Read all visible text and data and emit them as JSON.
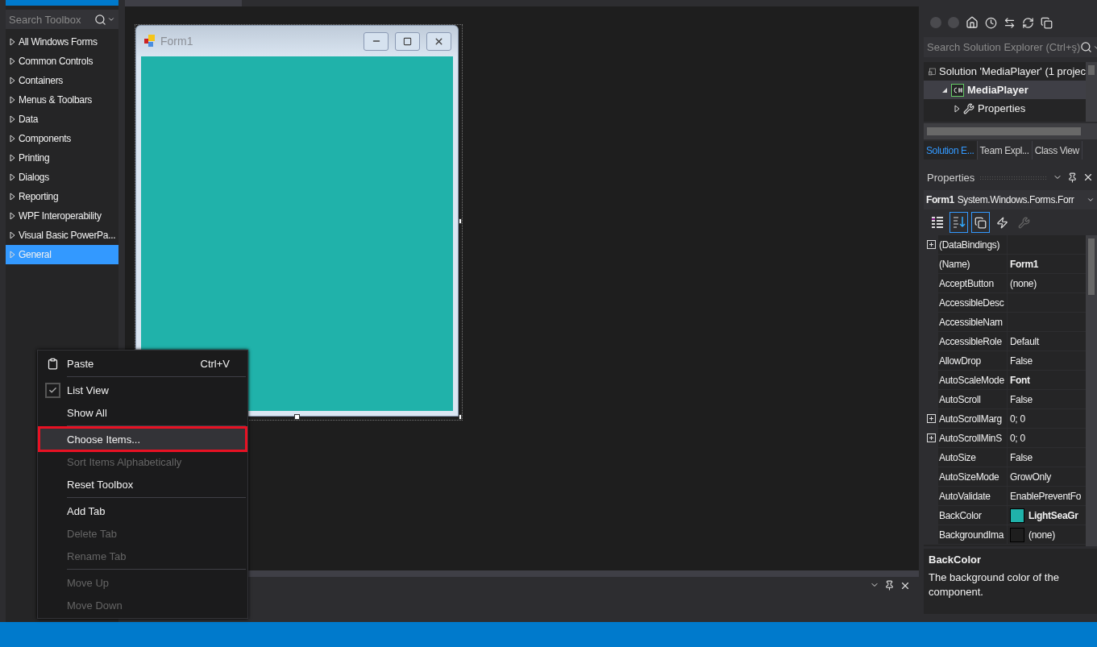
{
  "toolbox": {
    "search": {
      "placeholder": "Search Toolbox"
    },
    "items": [
      {
        "label": "All Windows Forms",
        "selected": false
      },
      {
        "label": "Common Controls",
        "selected": false
      },
      {
        "label": "Containers",
        "selected": false
      },
      {
        "label": "Menus & Toolbars",
        "selected": false
      },
      {
        "label": "Data",
        "selected": false
      },
      {
        "label": "Components",
        "selected": false
      },
      {
        "label": "Printing",
        "selected": false
      },
      {
        "label": "Dialogs",
        "selected": false
      },
      {
        "label": "Reporting",
        "selected": false
      },
      {
        "label": "WPF Interoperability",
        "selected": false
      },
      {
        "label": "Visual Basic PowerPa...",
        "selected": false
      },
      {
        "label": "General",
        "selected": true
      }
    ]
  },
  "designer": {
    "form": {
      "title": "Form1"
    }
  },
  "context_menu": {
    "items": [
      {
        "kind": "item",
        "label": "Paste",
        "shortcut": "Ctrl+V",
        "checked": false,
        "disabled": false,
        "selected": false
      },
      {
        "kind": "separator"
      },
      {
        "kind": "item",
        "label": "List View",
        "checked": true,
        "disabled": false,
        "selected": false
      },
      {
        "kind": "item",
        "label": "Show All",
        "checked": false,
        "disabled": false,
        "selected": false
      },
      {
        "kind": "separator"
      },
      {
        "kind": "item",
        "label": "Choose Items...",
        "checked": false,
        "disabled": false,
        "selected": true
      },
      {
        "kind": "item",
        "label": "Sort Items Alphabetically",
        "checked": false,
        "disabled": true,
        "selected": false
      },
      {
        "kind": "item",
        "label": "Reset Toolbox",
        "checked": false,
        "disabled": false,
        "selected": false
      },
      {
        "kind": "separator"
      },
      {
        "kind": "item",
        "label": "Add Tab",
        "checked": false,
        "disabled": false,
        "selected": false
      },
      {
        "kind": "item",
        "label": "Delete Tab",
        "checked": false,
        "disabled": true,
        "selected": false
      },
      {
        "kind": "item",
        "label": "Rename Tab",
        "checked": false,
        "disabled": true,
        "selected": false
      },
      {
        "kind": "separator"
      },
      {
        "kind": "item",
        "label": "Move Up",
        "checked": false,
        "disabled": true,
        "selected": false
      },
      {
        "kind": "item",
        "label": "Move Down",
        "checked": false,
        "disabled": true,
        "selected": false
      }
    ]
  },
  "solution_explorer": {
    "search": {
      "placeholder": "Search Solution Explorer (Ctrl+ş)"
    },
    "tree": [
      {
        "label": "Solution 'MediaPlayer' (1 projec",
        "selected": false,
        "children": [
          {
            "label": "MediaPlayer",
            "expanded": true,
            "selected": true,
            "children": [
              {
                "label": "Properties",
                "expanded": false,
                "selected": false
              }
            ]
          }
        ]
      }
    ],
    "tabs": [
      {
        "label": "Solution E...",
        "selected": true
      },
      {
        "label": "Team Expl...",
        "selected": false
      },
      {
        "label": "Class View",
        "selected": false
      }
    ]
  },
  "properties": {
    "title": "Properties",
    "object": {
      "name": "Form1",
      "type": "System.Windows.Forms.Forr"
    },
    "toolbar": [
      {
        "selected": false
      },
      {
        "selected": true
      },
      {
        "selected": true
      },
      {
        "selected": false
      },
      {
        "selected": false
      }
    ],
    "rows": [
      {
        "name": "(DataBindings)",
        "expandable": true
      },
      {
        "name": "(Name)",
        "value": "Form1",
        "bold": true,
        "expandable": false
      },
      {
        "name": "AcceptButton",
        "value": "(none)",
        "bold": false,
        "expandable": false
      },
      {
        "name": "AccessibleDesc",
        "expandable": false
      },
      {
        "name": "AccessibleNam",
        "expandable": false
      },
      {
        "name": "AccessibleRole",
        "value": "Default",
        "bold": false,
        "expandable": false
      },
      {
        "name": "AllowDrop",
        "value": "False",
        "bold": false,
        "expandable": false
      },
      {
        "name": "AutoScaleMode",
        "value": "Font",
        "bold": true,
        "expandable": false
      },
      {
        "name": "AutoScroll",
        "value": "False",
        "bold": false,
        "expandable": false
      },
      {
        "name": "AutoScrollMarg",
        "value": "0; 0",
        "bold": false,
        "expandable": true
      },
      {
        "name": "AutoScrollMinS",
        "value": "0; 0",
        "bold": false,
        "expandable": true
      },
      {
        "name": "AutoSize",
        "value": "False",
        "bold": false,
        "expandable": false
      },
      {
        "name": "AutoSizeMode",
        "value": "GrowOnly",
        "bold": false,
        "expandable": false
      },
      {
        "name": "AutoValidate",
        "value": "EnablePreventFo",
        "bold": false,
        "expandable": false
      },
      {
        "name": "BackColor",
        "value": "LightSeaGr",
        "bold": true,
        "expandable": false,
        "color": "#20b2aa"
      },
      {
        "name": "BackgroundIma",
        "value": "(none)",
        "bold": false,
        "expandable": false,
        "color": "#1e1e1e"
      }
    ],
    "description": {
      "title": "BackColor",
      "text": "The background color of the component."
    }
  }
}
